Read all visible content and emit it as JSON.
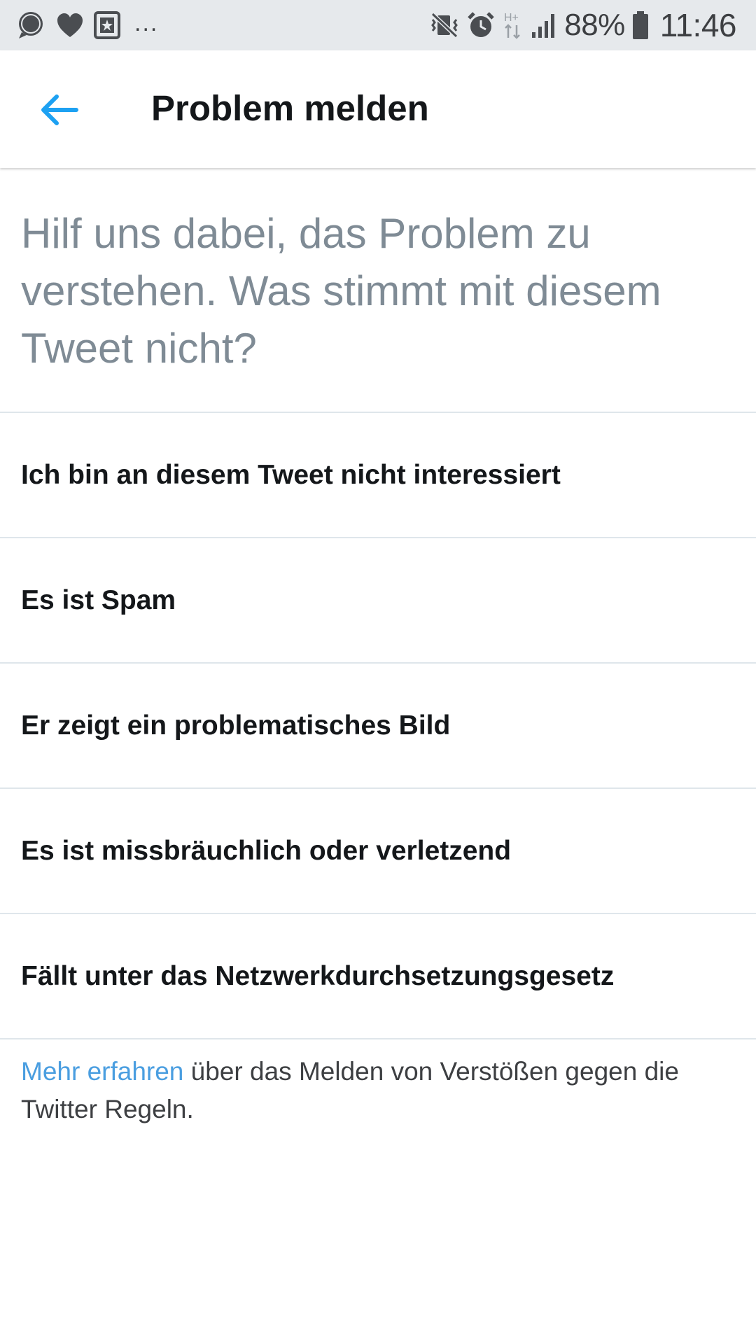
{
  "status_bar": {
    "left_icons": [
      "chat-bubble-icon",
      "heart-icon",
      "star-badge-icon"
    ],
    "overflow": "...",
    "right_icons": [
      "vibrate-mute-icon",
      "alarm-icon",
      "network-hplus-icon",
      "signal-icon",
      "battery-icon"
    ],
    "network_type": "H+",
    "battery_percent": "88%",
    "time": "11:46"
  },
  "header": {
    "back_icon": "arrow-left-icon",
    "title": "Problem melden"
  },
  "question": "Hilf uns dabei, das Problem zu verstehen. Was stimmt mit diesem Tweet nicht?",
  "options": [
    {
      "label": "Ich bin an diesem Tweet nicht interessiert"
    },
    {
      "label": "Es ist Spam"
    },
    {
      "label": "Er zeigt ein problematisches Bild"
    },
    {
      "label": "Es ist missbräuchlich oder verletzend"
    },
    {
      "label": "Fällt unter das Netzwerkdurchsetzungsgesetz"
    }
  ],
  "footer": {
    "link_text": "Mehr erfahren",
    "text": " über das Melden von Verstößen gegen die Twitter Regeln."
  },
  "colors": {
    "accent": "#1da1f2",
    "link": "#4a9ee0",
    "question_text": "#7f8b95",
    "primary_text": "#14171a",
    "status_bar_bg": "#e6e9ec",
    "divider": "#dfe6eb"
  }
}
